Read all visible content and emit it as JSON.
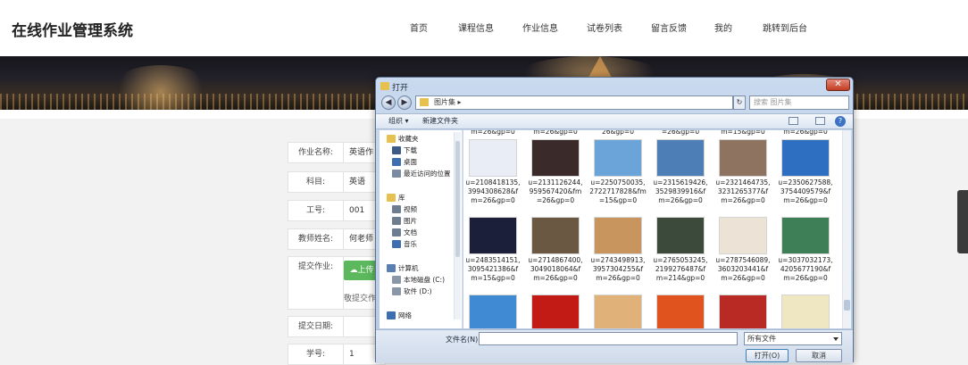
{
  "site": {
    "title": "在线作业管理系统",
    "nav": [
      "首页",
      "课程信息",
      "作业信息",
      "试卷列表",
      "留言反馈",
      "我的",
      "跳转到后台"
    ]
  },
  "form": {
    "rows": [
      {
        "label": "作业名称:",
        "value": "英语作"
      },
      {
        "label": "科目:",
        "value": "英语"
      },
      {
        "label": "工号:",
        "value": "001"
      },
      {
        "label": "教师姓名:",
        "value": "何老师"
      },
      {
        "label": "提交作业:",
        "value": ""
      },
      {
        "label": "提交日期:",
        "value": ""
      },
      {
        "label": "学号:",
        "value": "1"
      }
    ],
    "upload_label": "上传",
    "upload_hint": "敬提交作业"
  },
  "dialog": {
    "title": "打开",
    "close": "✕",
    "path": "图片集 ▸",
    "search_placeholder": "搜索 图片集",
    "toolbar": {
      "organize": "组织 ▾",
      "new_folder": "新建文件夹"
    },
    "nav_items": [
      {
        "label": "收藏夹",
        "icon": "star-icon",
        "color": "#e7c14f"
      },
      {
        "label": "下载",
        "icon": "download-folder-icon",
        "color": "#3d5a86"
      },
      {
        "label": "桌面",
        "icon": "desktop-icon",
        "color": "#3d6fb0"
      },
      {
        "label": "最近访问的位置",
        "icon": "recent-places-icon",
        "color": "#7a8aa0"
      },
      {
        "label": "库",
        "icon": "library-icon",
        "color": "#e7c14f"
      },
      {
        "label": "视频",
        "icon": "video-library-icon",
        "color": "#6f7d90"
      },
      {
        "label": "图片",
        "icon": "pictures-library-icon",
        "color": "#6f7d90"
      },
      {
        "label": "文档",
        "icon": "documents-library-icon",
        "color": "#6f7d90"
      },
      {
        "label": "音乐",
        "icon": "music-library-icon",
        "color": "#3d6fb0"
      },
      {
        "label": "计算机",
        "icon": "computer-icon",
        "color": "#5a7fb5"
      },
      {
        "label": "本地磁盘 (C:)",
        "icon": "drive-c-icon",
        "color": "#8a97a8"
      },
      {
        "label": "软件 (D:)",
        "icon": "drive-d-icon",
        "color": "#8a97a8"
      },
      {
        "label": "网络",
        "icon": "network-icon",
        "color": "#3d6fb0"
      }
    ],
    "top_captions": [
      "m=26&gp=0",
      "m=26&gp=0",
      "26&gp=0",
      "=26&gp=0",
      "m=15&gp=0",
      "m=26&gp=0"
    ],
    "files": [
      {
        "caption": "u=2108418135,\n3994308628&f\nm=26&gp=0",
        "color": "#e9eef6"
      },
      {
        "caption": "u=2131126244,\n959567420&fm\n=26&gp=0",
        "color": "#3a2a2a"
      },
      {
        "caption": "u=2250750035,\n2722717828&fm\n=15&gp=0",
        "color": "#6aa4d8"
      },
      {
        "caption": "u=2315619426,\n3529839916&f\nm=26&gp=0",
        "color": "#4d7fb6"
      },
      {
        "caption": "u=2321464735,\n3231265377&f\nm=26&gp=0",
        "color": "#8d7360"
      },
      {
        "caption": "u=2350627588,\n3754409579&f\nm=26&gp=0",
        "color": "#2f6fc2"
      },
      {
        "caption": "u=2483514151,\n3095421386&f\nm=15&gp=0",
        "color": "#1b1f3a"
      },
      {
        "caption": "u=2714867400,\n3049018064&f\nm=26&gp=0",
        "color": "#6b5842"
      },
      {
        "caption": "u=2743498913,\n3957304255&f\nm=26&gp=0",
        "color": "#c8955e"
      },
      {
        "caption": "u=2765053245,\n2199276487&f\nm=214&gp=0",
        "color": "#3b4a3a"
      },
      {
        "caption": "u=2787546089,\n3603203441&f\nm=26&gp=0",
        "color": "#ece3d6"
      },
      {
        "caption": "u=3037032173,\n4205677190&f\nm=26&gp=0",
        "color": "#3e7f58"
      },
      {
        "caption": "",
        "color": "#3f8ad2"
      },
      {
        "caption": "",
        "color": "#c21a14"
      },
      {
        "caption": "",
        "color": "#e0b27a"
      },
      {
        "caption": "",
        "color": "#e0531e"
      },
      {
        "caption": "",
        "color": "#b92a25"
      },
      {
        "caption": "",
        "color": "#efe6c2"
      }
    ],
    "filename_label": "文件名(N):",
    "filename_value": "",
    "filetype": "所有文件",
    "open": "打开(O)",
    "cancel": "取消"
  }
}
